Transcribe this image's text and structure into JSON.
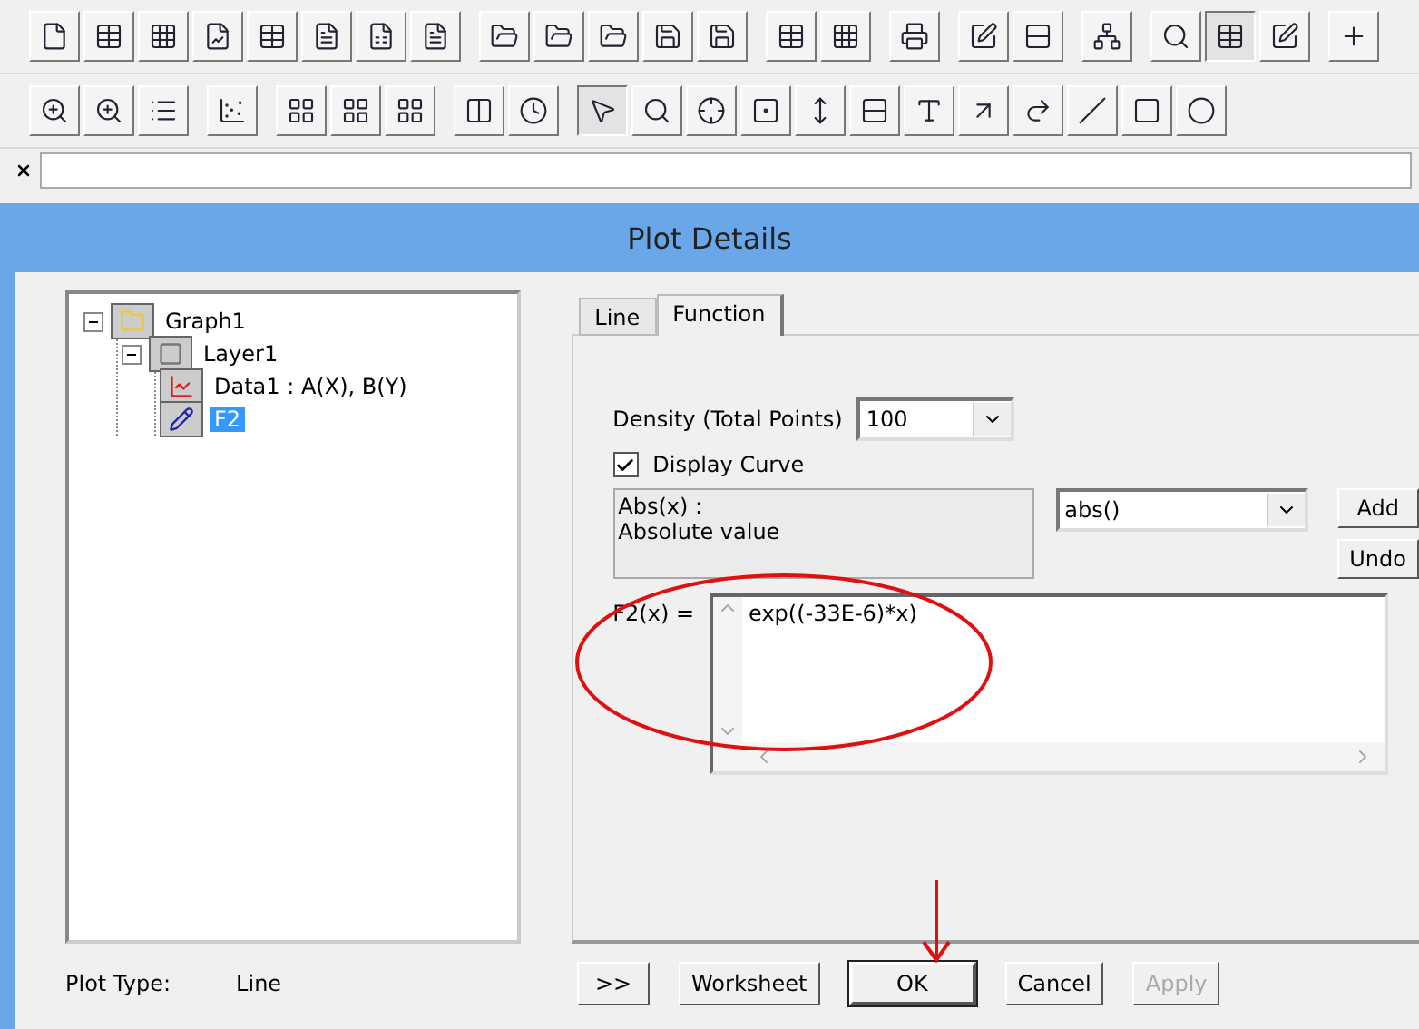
{
  "window": {
    "title": "Plot Details"
  },
  "tree": [
    {
      "label": "Graph1",
      "kind": "graph",
      "expanded": true,
      "selected": false,
      "children": [
        {
          "label": "Layer1",
          "kind": "layer",
          "expanded": true,
          "selected": false,
          "children": [
            {
              "label": "Data1 : A(X), B(Y)",
              "kind": "data",
              "selected": false
            },
            {
              "label": "F2",
              "kind": "function",
              "selected": true
            }
          ]
        }
      ]
    }
  ],
  "tabs": [
    {
      "label": "Line",
      "selected": false
    },
    {
      "label": "Function",
      "selected": true
    }
  ],
  "density": {
    "label": "Density (Total Points)",
    "value": "100"
  },
  "display_curve": {
    "label": "Display Curve",
    "checked": true
  },
  "description": [
    "Abs(x) :",
    "Absolute value"
  ],
  "function_select": {
    "value": "abs()"
  },
  "side_buttons": [
    "Add",
    "Undo"
  ],
  "formula": {
    "label": "F2(x) =",
    "value": "exp((-33E-6)*x)"
  },
  "plot_type": {
    "label": "Plot Type:",
    "value": "Line"
  },
  "footer_buttons": [
    {
      "label": ">>",
      "default": false,
      "disabled": false
    },
    {
      "label": "Worksheet",
      "default": false,
      "disabled": false
    },
    {
      "label": "OK",
      "default": true,
      "disabled": false
    },
    {
      "label": "Cancel",
      "default": false,
      "disabled": false
    },
    {
      "label": "Apply",
      "default": false,
      "disabled": true
    }
  ]
}
